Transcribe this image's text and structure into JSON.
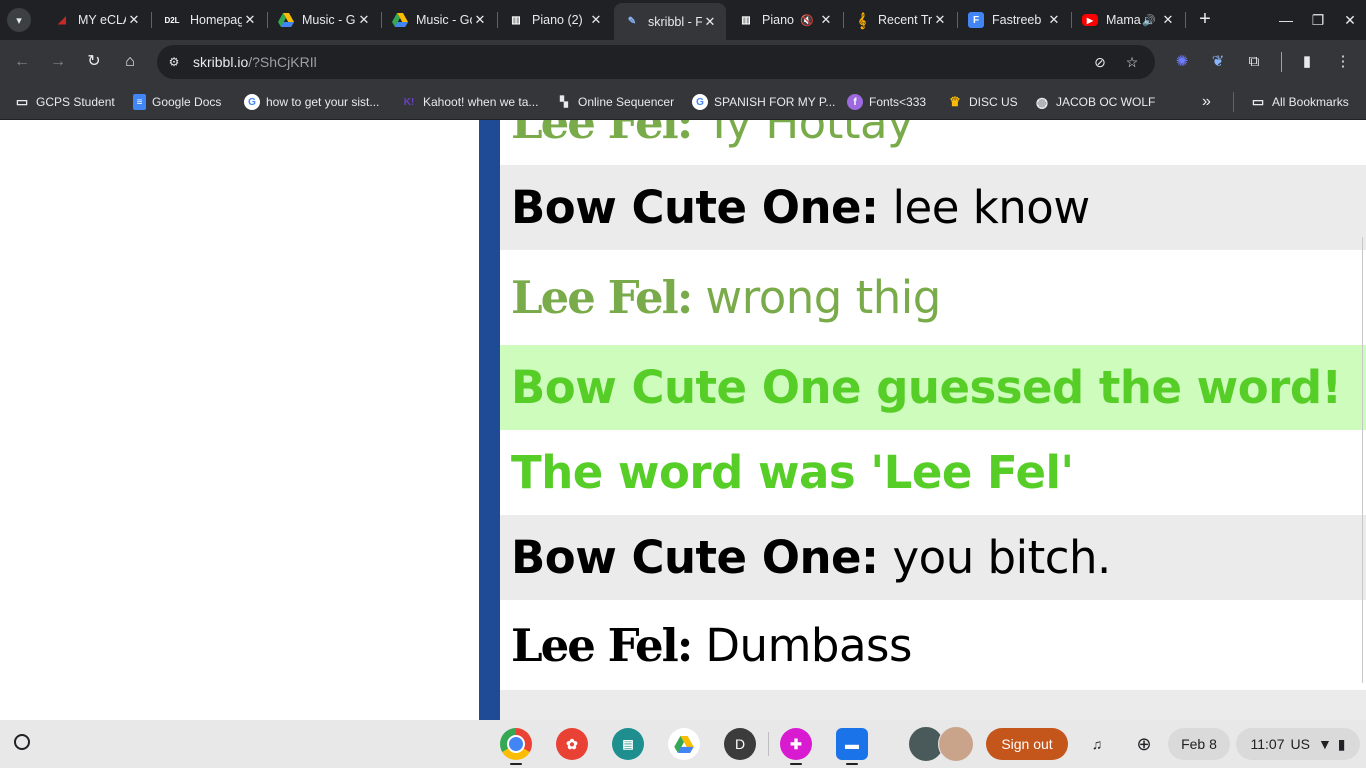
{
  "browser": {
    "tabs": [
      {
        "title": "MY eCLASS",
        "favicon": "eclass-icon",
        "fav_color": "#c62828",
        "active": false
      },
      {
        "title": "Homepage",
        "favicon": "d2l-icon",
        "fav_color": "#ffffff",
        "active": false
      },
      {
        "title": "Music - Google Drive",
        "favicon": "drive-icon",
        "fav_color": "#fbbc04",
        "active": false
      },
      {
        "title": "Music - Google Drive",
        "favicon": "drive-icon",
        "fav_color": "#fbbc04",
        "active": false
      },
      {
        "title": "Piano (2)",
        "favicon": "piano-icon",
        "fav_color": "#ffffff",
        "active": false
      },
      {
        "title": "skribbl - Free Multiplayer",
        "favicon": "skribbl-icon",
        "fav_color": "#8ab4f8",
        "active": true
      },
      {
        "title": "Piano",
        "favicon": "piano-icon",
        "fav_color": "#ffffff",
        "active": false,
        "audio": "muted"
      },
      {
        "title": "Recent Tracks",
        "favicon": "treble-clef-icon",
        "fav_color": "#f9ab00",
        "active": false
      },
      {
        "title": "Fastreeb",
        "favicon": "fastreeb-icon",
        "fav_color": "#4285f4",
        "active": false
      },
      {
        "title": "Mama",
        "favicon": "youtube-icon",
        "fav_color": "#ff0000",
        "active": false,
        "audio": "playing"
      }
    ],
    "url_host": "skribbl.io",
    "url_path": "/?ShCjKRIl",
    "bookmarks": [
      {
        "label": "GCPS Student",
        "icon": "folder-icon"
      },
      {
        "label": "Google Docs",
        "icon": "docs-icon"
      },
      {
        "label": "how to get your sist...",
        "icon": "google-icon"
      },
      {
        "label": "Kahoot! when we ta...",
        "icon": "kahoot-icon"
      },
      {
        "label": "Online Sequencer",
        "icon": "sequencer-icon"
      },
      {
        "label": "SPANISH FOR MY P...",
        "icon": "google-icon"
      },
      {
        "label": "Fonts<333",
        "icon": "fonts-icon"
      },
      {
        "label": "DISC US",
        "icon": "crown-icon"
      },
      {
        "label": "JACOB OC WOLF",
        "icon": "globe-icon"
      }
    ],
    "all_bookmarks": "All Bookmarks"
  },
  "chat": {
    "messages": [
      {
        "author": "Lee Fel:",
        "text": "Ty Hottay",
        "style": "lee"
      },
      {
        "author": "Bow Cute One:",
        "text": "lee know",
        "style": "bow"
      },
      {
        "author": "Lee Fel:",
        "text": "wrong thig",
        "style": "lee"
      },
      {
        "author": "",
        "text": "Bow Cute One guessed the word!",
        "style": "guessed"
      },
      {
        "author": "",
        "text": "The word was 'Lee Fel'",
        "style": "system"
      },
      {
        "author": "Bow Cute One:",
        "text": "you bitch.",
        "style": "bow"
      },
      {
        "author": "Lee Fel:",
        "text": "Dumbass",
        "style": "lee-dark"
      }
    ],
    "colors": {
      "guessed": "#56ce27",
      "lee": "#7aab4a",
      "sidebar": "#1f4a96"
    }
  },
  "shelf": {
    "apps": [
      "chrome-icon",
      "canvas-icon",
      "classroom-icon",
      "drive-icon",
      "d-app-icon",
      "plus-app-icon",
      "files-icon"
    ],
    "d_app_letter": "D",
    "sign_out": "Sign out",
    "date": "Feb 8",
    "time": "11:07",
    "locale": "US"
  }
}
